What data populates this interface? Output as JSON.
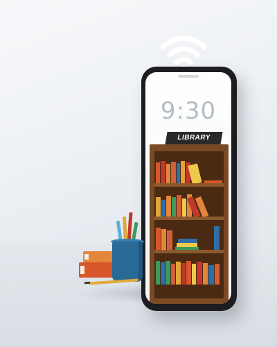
{
  "phone": {
    "time": "9:30",
    "date": "",
    "sign": "LIBRARY"
  },
  "colors": {
    "shelf_wood": "#7a4a24",
    "shelf_back": "#4a2a12",
    "phone_body": "#1d1d1f",
    "cup": "#2a6a96"
  },
  "icons": {
    "wifi": "wifi-icon"
  }
}
